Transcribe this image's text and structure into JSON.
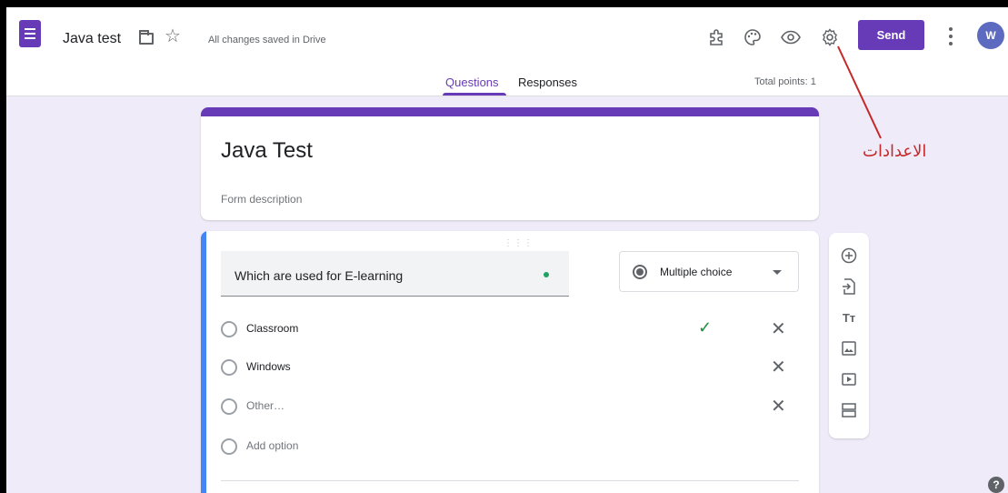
{
  "header": {
    "doc_title": "Java test",
    "save_status": "All changes saved in Drive",
    "send_label": "Send",
    "avatar_initial": "W",
    "icons": [
      "addons-icon",
      "palette-icon",
      "preview-eye-icon",
      "settings-gear-icon"
    ]
  },
  "tabs": {
    "questions": "Questions",
    "responses": "Responses",
    "total_points": "Total points: 1"
  },
  "form": {
    "title": "Java Test",
    "description_placeholder": "Form description"
  },
  "question": {
    "text": "Which are used for E-learning",
    "type": "Multiple choice",
    "options": [
      {
        "label": "Classroom",
        "correct": true
      },
      {
        "label": "Windows",
        "correct": false
      },
      {
        "label": "Other…",
        "correct": false
      }
    ],
    "add_option": "Add option"
  },
  "side_toolbar": [
    "add-question-icon",
    "import-questions-icon",
    "add-title-icon",
    "add-image-icon",
    "add-video-icon",
    "add-section-icon"
  ],
  "annotation": {
    "text": "الاعدادات",
    "color": "#c62828"
  },
  "colors": {
    "accent": "#673ab7",
    "background": "#f0ebf8",
    "question_border": "#4285f4"
  }
}
